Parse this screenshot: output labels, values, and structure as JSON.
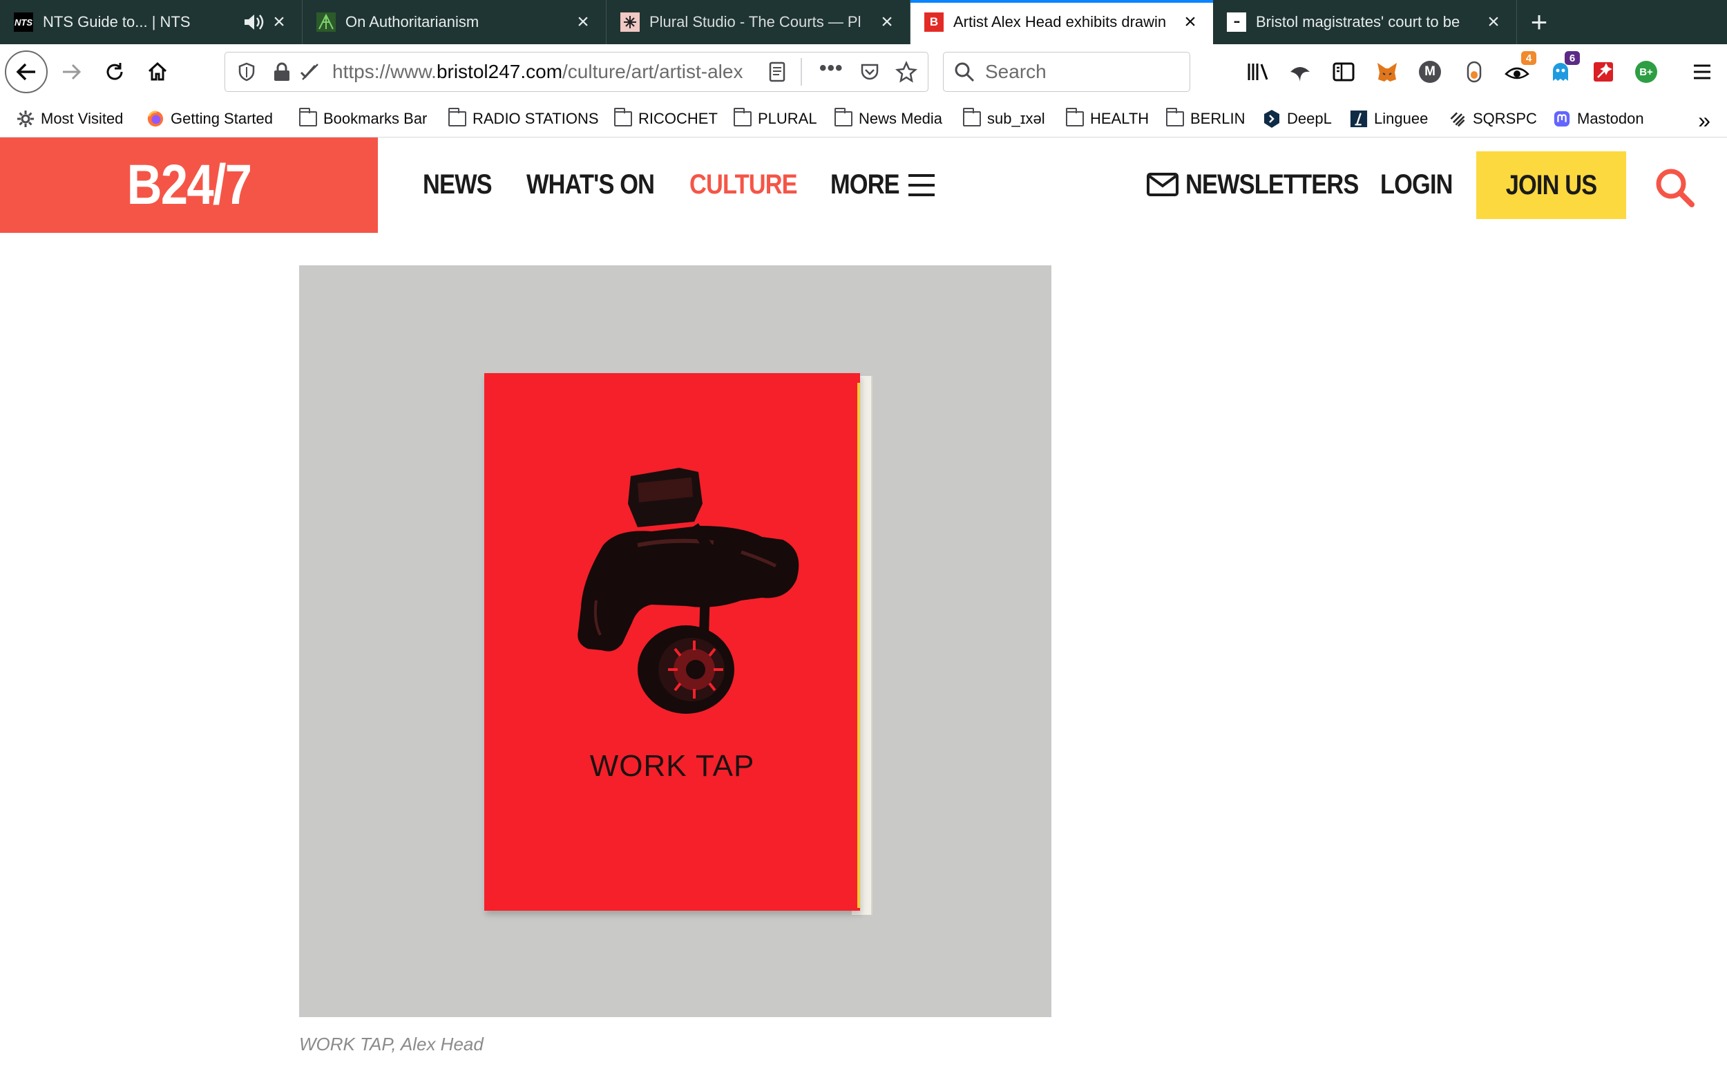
{
  "browser": {
    "tabs": [
      {
        "title": "NTS Guide to... | NTS",
        "favicon": "NTS",
        "audio": true
      },
      {
        "title": "On Authoritarianism",
        "favicon": ""
      },
      {
        "title": "Plural Studio - The Courts — Pl",
        "favicon": ""
      },
      {
        "title": "Artist Alex Head exhibits drawin",
        "favicon": "B",
        "active": true
      },
      {
        "title": "Bristol magistrates' court to be",
        "favicon": "▪▪▪"
      }
    ],
    "url_prefix": "https://www.",
    "url_domain": "bristol247.com",
    "url_path": "/culture/art/artist-alex",
    "search_placeholder": "Search",
    "badges": {
      "extension_4": "4",
      "extension_6": "6",
      "extension_b": "B+",
      "extension_m": "M"
    }
  },
  "bookmarks": [
    {
      "label": "Most Visited",
      "icon": "gear-icon"
    },
    {
      "label": "Getting Started",
      "icon": "firefox-icon"
    },
    {
      "label": "Bookmarks Bar",
      "icon": "folder-icon"
    },
    {
      "label": "RADIO STATIONS",
      "icon": "folder-icon"
    },
    {
      "label": "RICOCHET",
      "icon": "folder-icon"
    },
    {
      "label": "PLURAL",
      "icon": "folder-icon"
    },
    {
      "label": "News Media",
      "icon": "folder-icon"
    },
    {
      "label": "sub_ɪxǝl",
      "icon": "folder-icon"
    },
    {
      "label": "HEALTH",
      "icon": "folder-icon"
    },
    {
      "label": "BERLIN",
      "icon": "folder-icon"
    },
    {
      "label": "DeepL",
      "icon": "deepl-icon"
    },
    {
      "label": "Linguee",
      "icon": "linguee-icon"
    },
    {
      "label": "SQRSPC",
      "icon": "sqrspc-icon"
    },
    {
      "label": "Mastodon",
      "icon": "mastodon-icon"
    }
  ],
  "site": {
    "logo": "B24/7",
    "nav": {
      "news": "NEWS",
      "whats_on": "WHAT'S ON",
      "culture": "CULTURE",
      "more": "MORE",
      "newsletters": "NEWSLETTERS",
      "login": "LOGIN",
      "join": "JOIN US"
    },
    "colors": {
      "brand": "#f55547",
      "join": "#fdd940"
    }
  },
  "article": {
    "image_text": "WORK TAP",
    "caption": "WORK TAP, Alex Head"
  }
}
